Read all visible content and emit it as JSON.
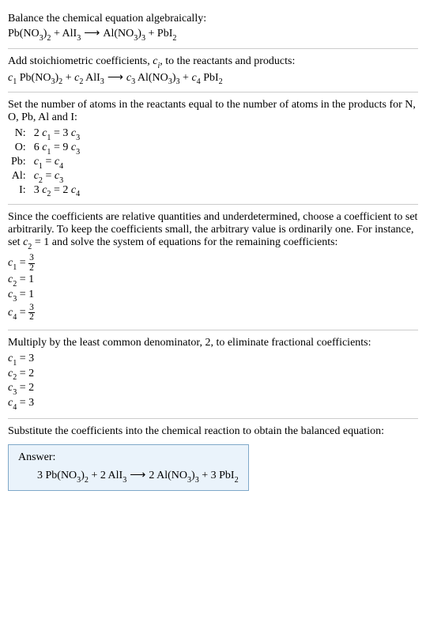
{
  "section1": {
    "heading": "Balance the chemical equation algebraically:",
    "equation": "Pb(NO₃)₂ + AlI₃ ⟶ Al(NO₃)₃ + PbI₂"
  },
  "section2": {
    "heading_pre": "Add stoichiometric coefficients, ",
    "heading_ci": "cᵢ",
    "heading_post": ", to the reactants and products:",
    "equation": "c₁ Pb(NO₃)₂ + c₂ AlI₃ ⟶ c₃ Al(NO₃)₃ + c₄ PbI₂"
  },
  "section3": {
    "heading": "Set the number of atoms in the reactants equal to the number of atoms in the products for N, O, Pb, Al and I:",
    "rows": [
      {
        "el": "N:",
        "eq": "2 c₁ = 3 c₃"
      },
      {
        "el": "O:",
        "eq": "6 c₁ = 9 c₃"
      },
      {
        "el": "Pb:",
        "eq": "c₁ = c₄"
      },
      {
        "el": "Al:",
        "eq": "c₂ = c₃"
      },
      {
        "el": "I:",
        "eq": "3 c₂ = 2 c₄"
      }
    ]
  },
  "section4": {
    "heading": "Since the coefficients are relative quantities and underdetermined, choose a coefficient to set arbitrarily. To keep the coefficients small, the arbitrary value is ordinarily one. For instance, set c₂ = 1 and solve the system of equations for the remaining coefficients:",
    "c1": {
      "lhs": "c₁ = ",
      "num": "3",
      "den": "2"
    },
    "c2": "c₂ = 1",
    "c3": "c₃ = 1",
    "c4": {
      "lhs": "c₄ = ",
      "num": "3",
      "den": "2"
    }
  },
  "section5": {
    "heading": "Multiply by the least common denominator, 2, to eliminate fractional coefficients:",
    "c1": "c₁ = 3",
    "c2": "c₂ = 2",
    "c3": "c₃ = 2",
    "c4": "c₄ = 3"
  },
  "section6": {
    "heading": "Substitute the coefficients into the chemical reaction to obtain the balanced equation:",
    "answer_label": "Answer:",
    "answer_eq": "3 Pb(NO₃)₂ + 2 AlI₃ ⟶ 2 Al(NO₃)₃ + 3 PbI₂"
  },
  "chart_data": {
    "type": "table",
    "title": "Balanced chemical equation coefficients",
    "reaction_unbalanced": "Pb(NO3)2 + AlI3 -> Al(NO3)3 + PbI2",
    "atom_balance_equations": {
      "N": "2 c1 = 3 c3",
      "O": "6 c1 = 9 c3",
      "Pb": "c1 = c4",
      "Al": "c2 = c3",
      "I": "3 c2 = 2 c4"
    },
    "solution_with_c2_eq_1": {
      "c1": 1.5,
      "c2": 1,
      "c3": 1,
      "c4": 1.5
    },
    "integer_solution": {
      "c1": 3,
      "c2": 2,
      "c3": 2,
      "c4": 3
    },
    "balanced_equation": "3 Pb(NO3)2 + 2 AlI3 -> 2 Al(NO3)3 + 3 PbI2"
  }
}
